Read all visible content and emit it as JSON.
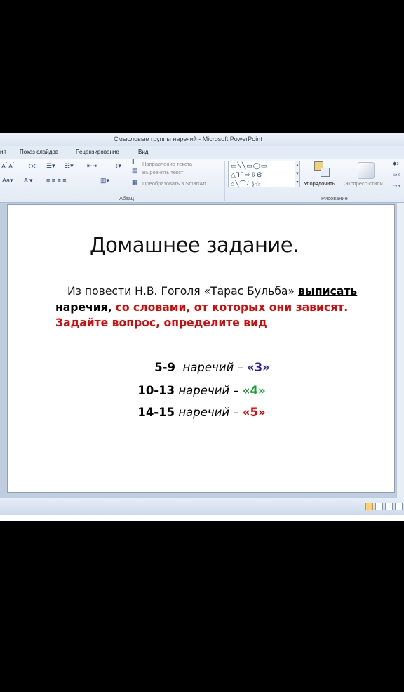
{
  "window": {
    "title": "Смысловые группы наречий  -  Microsoft PowerPoint"
  },
  "ribbon_tabs": [
    "ия",
    "Показ слайдов",
    "Рецензирование",
    "Вид"
  ],
  "ribbon": {
    "direction_text": "Направление текста",
    "align_text": "Выровнять текст",
    "smartart": "Преобразовать в SmartArt",
    "paragraph_group": "Абзац",
    "arrange": "Упорядочить",
    "express_styles": "Экспресс-стили",
    "drawing_group": "Рисование"
  },
  "slide": {
    "title": "Домашнее задание.",
    "instruction_lead": "Из повести Н.В. Гоголя «Тарас Бульба»",
    "instruction_bold_1": "выписать",
    "instruction_bold_2": "наречия,",
    "instruction_red": "со словами, от которых они зависят. Задайте вопрос, определите вид",
    "grades": [
      {
        "range": "5-9",
        "word": "наречий –",
        "mark": "«3»",
        "color": "#2b1aa6"
      },
      {
        "range": "10-13",
        "word": "наречий –",
        "mark": "«4»",
        "color": "#1f9c3a"
      },
      {
        "range": "14-15",
        "word": "наречий –",
        "mark": "«5»",
        "color": "#d10a0a"
      }
    ]
  }
}
